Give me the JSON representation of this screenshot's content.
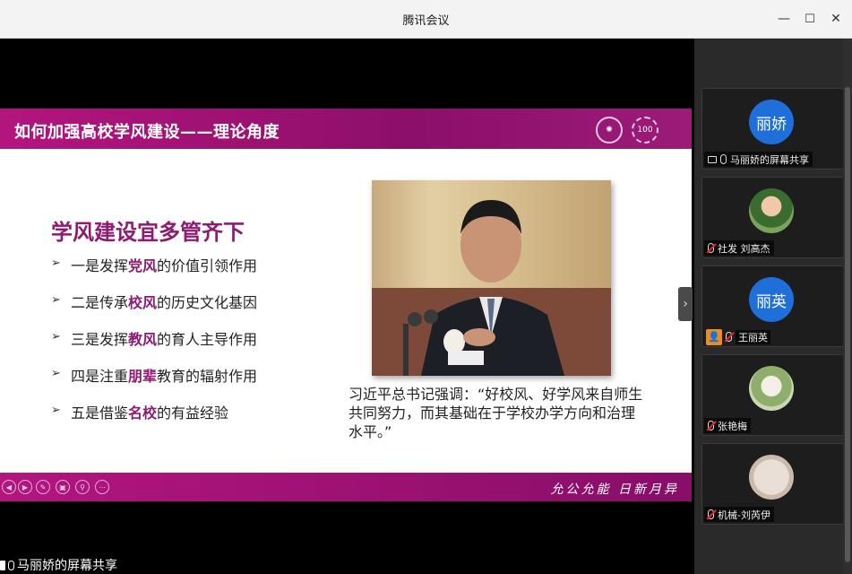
{
  "window": {
    "title": "腾讯会议",
    "minimize": "—",
    "maximize": "☐",
    "close": "✕"
  },
  "slide": {
    "title": "如何加强高校学风建设——理论角度",
    "heading": "学风建设宜多管齐下",
    "bullets": [
      {
        "pre": "一是发挥",
        "hl": "党风",
        "post": "的价值引领作用"
      },
      {
        "pre": "二是传承",
        "hl": "校风",
        "post": "的历史文化基因"
      },
      {
        "pre": "三是发挥",
        "hl": "教风",
        "post": "的育人主导作用"
      },
      {
        "pre": "四是注重",
        "hl": "朋辈",
        "post": "教育的辐射作用"
      },
      {
        "pre": "五是借鉴",
        "hl": "名校",
        "post": "的有益经验"
      }
    ],
    "quote": "习近平总书记强调：“好校风、好学风来自师生共同努力，而其基础在于学校办学方向和治理水平。”",
    "motto": "允公允能  日新月异",
    "emblem_right": "100"
  },
  "share_label": "马丽娇的屏幕共享",
  "participants": [
    {
      "avatar_text": "丽娇",
      "label": "马丽娇的屏幕共享",
      "type": "blue"
    },
    {
      "avatar_text": "",
      "label": "社发 刘高杰",
      "type": "photo1"
    },
    {
      "avatar_text": "丽英",
      "label": "王丽英",
      "type": "blue"
    },
    {
      "avatar_text": "",
      "label": "张艳梅",
      "type": "photo2"
    },
    {
      "avatar_text": "",
      "label": "机械-刘芮伊",
      "type": "photo3"
    }
  ],
  "colors": {
    "accent": "#8e1a72",
    "meeting_blue": "#1e6fd9"
  }
}
